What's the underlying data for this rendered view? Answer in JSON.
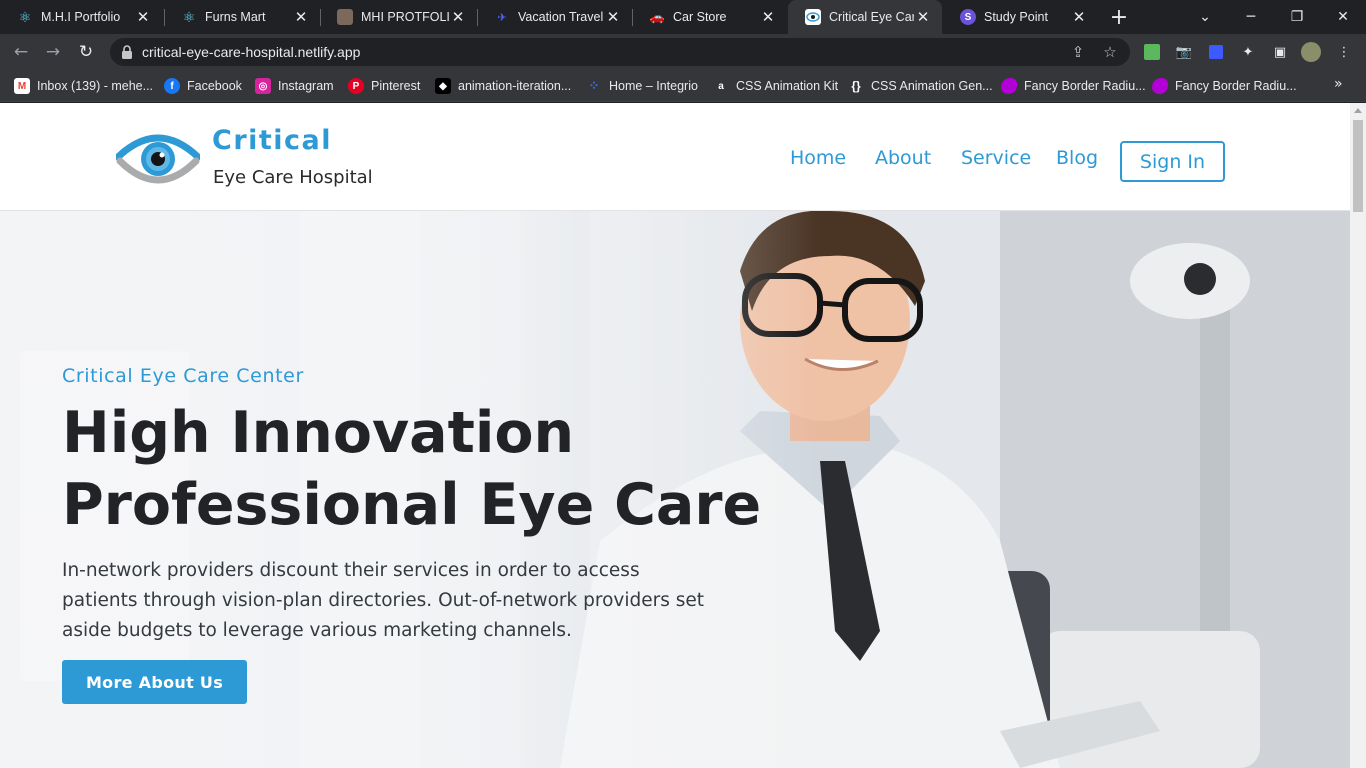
{
  "browser": {
    "tabs": [
      {
        "title": "M.H.I Portfolio",
        "icon": "react-icon",
        "active": false
      },
      {
        "title": "Furns Mart",
        "icon": "react-icon",
        "active": false
      },
      {
        "title": "MHI PROTFOLIO",
        "icon": "avatar-icon",
        "active": false
      },
      {
        "title": "Vacation Travel",
        "icon": "travel-icon",
        "active": false
      },
      {
        "title": "Car Store",
        "icon": "car-icon",
        "active": false
      },
      {
        "title": "Critical Eye Care",
        "icon": "eye-logo-icon",
        "active": true
      },
      {
        "title": "Study Point",
        "icon": "study-point-icon",
        "active": false
      }
    ],
    "new_tab_symbol": "+",
    "close_symbol": "✕",
    "url": "critical-eye-care-hospital.netlify.app",
    "bookmarks": [
      {
        "label": "Inbox (139) - mehe...",
        "icon": "gmail-icon",
        "color": "#ea4335"
      },
      {
        "label": "Facebook",
        "icon": "facebook-icon",
        "color": "#1877f2"
      },
      {
        "label": "Instagram",
        "icon": "instagram-icon",
        "color": "#d6249f"
      },
      {
        "label": "Pinterest",
        "icon": "pinterest-icon",
        "color": "#e60023"
      },
      {
        "label": "animation-iteration...",
        "icon": "mdn-icon",
        "color": "#000000"
      },
      {
        "label": "Home – Integrio",
        "icon": "integrio-icon",
        "color": "#3b6df0"
      },
      {
        "label": "CSS Animation Kit",
        "icon": "animation-kit-icon",
        "color": "#1a1a2e"
      },
      {
        "label": "CSS Animation Gen...",
        "icon": "curly-braces-icon",
        "color": "#35363a"
      },
      {
        "label": "Fancy Border Radiu...",
        "icon": "fancy-border-icon",
        "color": "#b300d6"
      },
      {
        "label": "Fancy Border Radiu...",
        "icon": "fancy-border-icon",
        "color": "#b300d6"
      }
    ],
    "bookmarks_more_symbol": "»"
  },
  "site": {
    "brand_name": "Critical",
    "brand_subtitle": "Eye Care Hospital",
    "nav": [
      "Home",
      "About",
      "Service",
      "Blog"
    ],
    "signin_label": "Sign In",
    "accent_color": "#2d9ad6"
  },
  "hero": {
    "eyebrow": "Critical Eye Care Center",
    "title_line1": "High Innovation",
    "title_line2": "Professional Eye Care",
    "description": "In-network providers discount their services in order to access patients through vision-plan directories. Out-of-network providers set aside budgets to leverage various marketing channels.",
    "button_label": "More About Us"
  }
}
